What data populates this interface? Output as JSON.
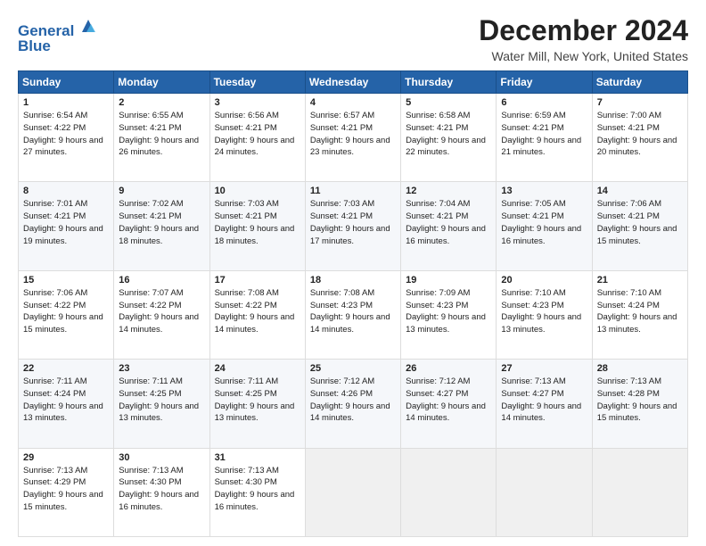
{
  "header": {
    "logo_line1": "General",
    "logo_line2": "Blue",
    "title": "December 2024",
    "subtitle": "Water Mill, New York, United States"
  },
  "days_of_week": [
    "Sunday",
    "Monday",
    "Tuesday",
    "Wednesday",
    "Thursday",
    "Friday",
    "Saturday"
  ],
  "weeks": [
    [
      {
        "day": 1,
        "sunrise": "6:54 AM",
        "sunset": "4:22 PM",
        "daylight": "9 hours and 27 minutes."
      },
      {
        "day": 2,
        "sunrise": "6:55 AM",
        "sunset": "4:21 PM",
        "daylight": "9 hours and 26 minutes."
      },
      {
        "day": 3,
        "sunrise": "6:56 AM",
        "sunset": "4:21 PM",
        "daylight": "9 hours and 24 minutes."
      },
      {
        "day": 4,
        "sunrise": "6:57 AM",
        "sunset": "4:21 PM",
        "daylight": "9 hours and 23 minutes."
      },
      {
        "day": 5,
        "sunrise": "6:58 AM",
        "sunset": "4:21 PM",
        "daylight": "9 hours and 22 minutes."
      },
      {
        "day": 6,
        "sunrise": "6:59 AM",
        "sunset": "4:21 PM",
        "daylight": "9 hours and 21 minutes."
      },
      {
        "day": 7,
        "sunrise": "7:00 AM",
        "sunset": "4:21 PM",
        "daylight": "9 hours and 20 minutes."
      }
    ],
    [
      {
        "day": 8,
        "sunrise": "7:01 AM",
        "sunset": "4:21 PM",
        "daylight": "9 hours and 19 minutes."
      },
      {
        "day": 9,
        "sunrise": "7:02 AM",
        "sunset": "4:21 PM",
        "daylight": "9 hours and 18 minutes."
      },
      {
        "day": 10,
        "sunrise": "7:03 AM",
        "sunset": "4:21 PM",
        "daylight": "9 hours and 18 minutes."
      },
      {
        "day": 11,
        "sunrise": "7:03 AM",
        "sunset": "4:21 PM",
        "daylight": "9 hours and 17 minutes."
      },
      {
        "day": 12,
        "sunrise": "7:04 AM",
        "sunset": "4:21 PM",
        "daylight": "9 hours and 16 minutes."
      },
      {
        "day": 13,
        "sunrise": "7:05 AM",
        "sunset": "4:21 PM",
        "daylight": "9 hours and 16 minutes."
      },
      {
        "day": 14,
        "sunrise": "7:06 AM",
        "sunset": "4:21 PM",
        "daylight": "9 hours and 15 minutes."
      }
    ],
    [
      {
        "day": 15,
        "sunrise": "7:06 AM",
        "sunset": "4:22 PM",
        "daylight": "9 hours and 15 minutes."
      },
      {
        "day": 16,
        "sunrise": "7:07 AM",
        "sunset": "4:22 PM",
        "daylight": "9 hours and 14 minutes."
      },
      {
        "day": 17,
        "sunrise": "7:08 AM",
        "sunset": "4:22 PM",
        "daylight": "9 hours and 14 minutes."
      },
      {
        "day": 18,
        "sunrise": "7:08 AM",
        "sunset": "4:23 PM",
        "daylight": "9 hours and 14 minutes."
      },
      {
        "day": 19,
        "sunrise": "7:09 AM",
        "sunset": "4:23 PM",
        "daylight": "9 hours and 13 minutes."
      },
      {
        "day": 20,
        "sunrise": "7:10 AM",
        "sunset": "4:23 PM",
        "daylight": "9 hours and 13 minutes."
      },
      {
        "day": 21,
        "sunrise": "7:10 AM",
        "sunset": "4:24 PM",
        "daylight": "9 hours and 13 minutes."
      }
    ],
    [
      {
        "day": 22,
        "sunrise": "7:11 AM",
        "sunset": "4:24 PM",
        "daylight": "9 hours and 13 minutes."
      },
      {
        "day": 23,
        "sunrise": "7:11 AM",
        "sunset": "4:25 PM",
        "daylight": "9 hours and 13 minutes."
      },
      {
        "day": 24,
        "sunrise": "7:11 AM",
        "sunset": "4:25 PM",
        "daylight": "9 hours and 13 minutes."
      },
      {
        "day": 25,
        "sunrise": "7:12 AM",
        "sunset": "4:26 PM",
        "daylight": "9 hours and 14 minutes."
      },
      {
        "day": 26,
        "sunrise": "7:12 AM",
        "sunset": "4:27 PM",
        "daylight": "9 hours and 14 minutes."
      },
      {
        "day": 27,
        "sunrise": "7:13 AM",
        "sunset": "4:27 PM",
        "daylight": "9 hours and 14 minutes."
      },
      {
        "day": 28,
        "sunrise": "7:13 AM",
        "sunset": "4:28 PM",
        "daylight": "9 hours and 15 minutes."
      }
    ],
    [
      {
        "day": 29,
        "sunrise": "7:13 AM",
        "sunset": "4:29 PM",
        "daylight": "9 hours and 15 minutes."
      },
      {
        "day": 30,
        "sunrise": "7:13 AM",
        "sunset": "4:30 PM",
        "daylight": "9 hours and 16 minutes."
      },
      {
        "day": 31,
        "sunrise": "7:13 AM",
        "sunset": "4:30 PM",
        "daylight": "9 hours and 16 minutes."
      },
      null,
      null,
      null,
      null
    ]
  ],
  "labels": {
    "sunrise": "Sunrise:",
    "sunset": "Sunset:",
    "daylight": "Daylight:"
  }
}
